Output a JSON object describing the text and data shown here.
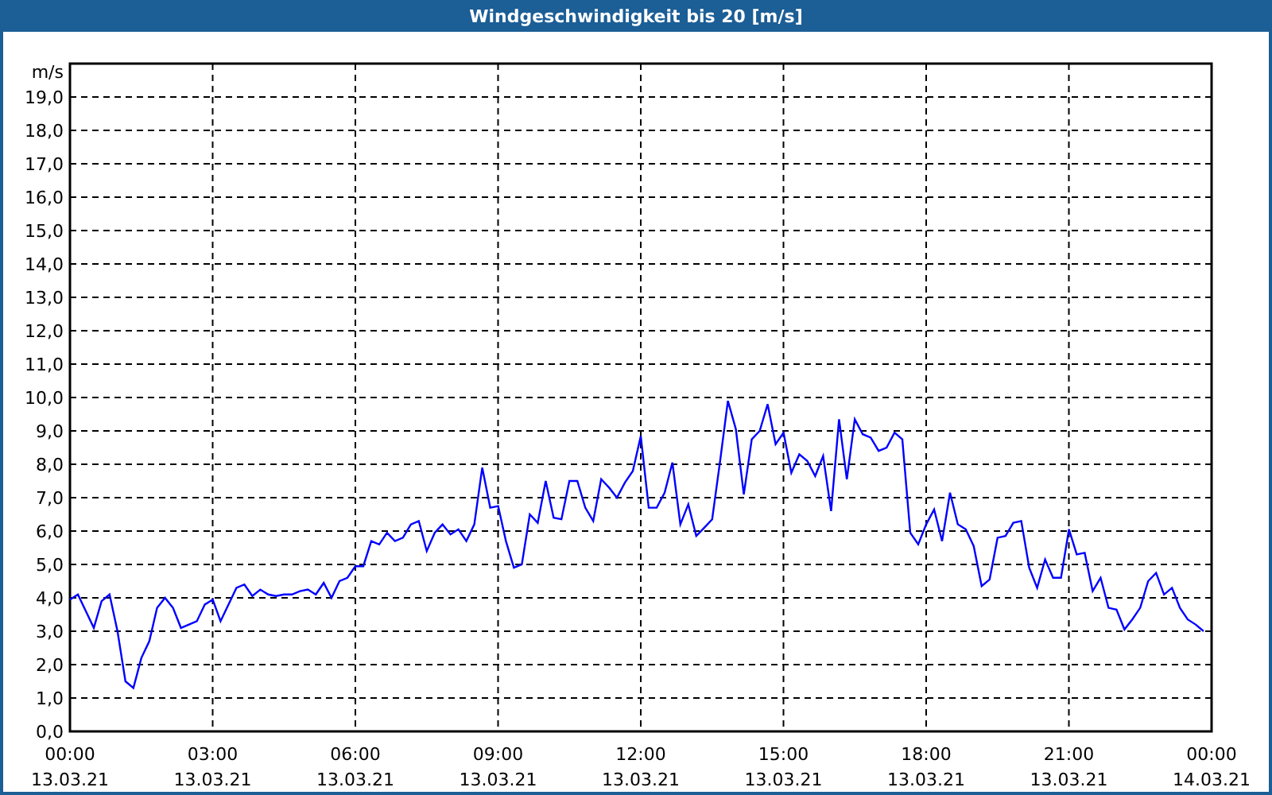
{
  "window": {
    "title": "Windgeschwindigkeit bis 20 [m/s]"
  },
  "chart_data": {
    "type": "line",
    "ylabel": "m/s",
    "categories": [
      "00:00\n13.03.21",
      null,
      null,
      null,
      null,
      null,
      null,
      null,
      null,
      null,
      null,
      null,
      null,
      null,
      null,
      null,
      null,
      null,
      "03:00\n13.03.21",
      null,
      null,
      null,
      null,
      null,
      null,
      null,
      null,
      null,
      null,
      null,
      null,
      null,
      null,
      null,
      null,
      null,
      "06:00\n13.03.21",
      null,
      null,
      null,
      null,
      null,
      null,
      null,
      null,
      null,
      null,
      null,
      null,
      null,
      null,
      null,
      null,
      null,
      "09:00\n13.03.21",
      null,
      null,
      null,
      null,
      null,
      null,
      null,
      null,
      null,
      null,
      null,
      null,
      null,
      null,
      null,
      null,
      null,
      "12:00\n13.03.21",
      null,
      null,
      null,
      null,
      null,
      null,
      null,
      null,
      null,
      null,
      null,
      null,
      null,
      null,
      null,
      null,
      null,
      "15:00\n13.03.21",
      null,
      null,
      null,
      null,
      null,
      null,
      null,
      null,
      null,
      null,
      null,
      null,
      null,
      null,
      null,
      null,
      null,
      "18:00\n13.03.21",
      null,
      null,
      null,
      null,
      null,
      null,
      null,
      null,
      null,
      null,
      null,
      null,
      null,
      null,
      null,
      null,
      null,
      "21:00\n13.03.21",
      null,
      null,
      null,
      null,
      null,
      null,
      null,
      null,
      null,
      null,
      null,
      null,
      null,
      null,
      null,
      null,
      null,
      "00:00\n14.03.21"
    ],
    "series": [
      {
        "color": "#0000ff",
        "values": [
          3.95,
          4.1,
          3.6,
          3.1,
          3.9,
          4.1,
          3.0,
          1.5,
          1.3,
          2.2,
          2.7,
          3.7,
          4.0,
          3.7,
          3.1,
          3.2,
          3.3,
          3.8,
          3.95,
          3.3,
          3.8,
          4.3,
          4.4,
          4.05,
          4.25,
          4.1,
          4.05,
          4.1,
          4.1,
          4.2,
          4.25,
          4.1,
          4.45,
          4.0,
          4.5,
          4.6,
          4.95,
          4.95,
          5.7,
          5.6,
          5.95,
          5.7,
          5.8,
          6.2,
          6.3,
          5.4,
          5.95,
          6.2,
          5.9,
          6.05,
          5.7,
          6.2,
          7.9,
          6.7,
          6.75,
          5.7,
          4.9,
          5.0,
          6.5,
          6.25,
          7.5,
          6.4,
          6.35,
          7.5,
          7.5,
          6.7,
          6.3,
          7.55,
          7.3,
          7.0,
          7.45,
          7.8,
          8.85,
          6.7,
          6.7,
          7.15,
          8.05,
          6.2,
          6.8,
          5.85,
          6.1,
          6.35,
          8.1,
          9.9,
          9.05,
          7.1,
          8.75,
          9.0,
          9.8,
          8.6,
          8.95,
          7.75,
          8.3,
          8.1,
          7.65,
          8.25,
          6.6,
          9.35,
          7.55,
          9.35,
          8.9,
          8.8,
          8.4,
          8.5,
          8.95,
          8.75,
          5.95,
          5.6,
          6.2,
          6.65,
          5.7,
          7.15,
          6.2,
          6.05,
          5.55,
          4.35,
          4.55,
          5.8,
          5.85,
          6.25,
          6.3,
          4.9,
          4.3,
          5.15,
          4.6,
          4.6,
          6.05,
          5.3,
          5.35,
          4.2,
          4.6,
          3.7,
          3.65,
          3.05,
          3.35,
          3.7,
          4.5,
          4.75,
          4.1,
          4.3,
          3.7,
          3.35,
          3.2,
          3.0,
          null
        ]
      }
    ],
    "grid": true,
    "ylim": [
      0,
      20
    ],
    "yticks": [
      {
        "value": 0,
        "label": "0,0"
      },
      {
        "value": 1,
        "label": "1,0"
      },
      {
        "value": 2,
        "label": "2,0"
      },
      {
        "value": 3,
        "label": "3,0"
      },
      {
        "value": 4,
        "label": "4,0"
      },
      {
        "value": 5,
        "label": "5,0"
      },
      {
        "value": 6,
        "label": "6,0"
      },
      {
        "value": 7,
        "label": "7,0"
      },
      {
        "value": 8,
        "label": "8,0"
      },
      {
        "value": 9,
        "label": "9,0"
      },
      {
        "value": 10,
        "label": "10,0"
      },
      {
        "value": 11,
        "label": "11,0"
      },
      {
        "value": 12,
        "label": "12,0"
      },
      {
        "value": 13,
        "label": "13,0"
      },
      {
        "value": 14,
        "label": "14,0"
      },
      {
        "value": 15,
        "label": "15,0"
      },
      {
        "value": 16,
        "label": "16,0"
      },
      {
        "value": 17,
        "label": "17,0"
      },
      {
        "value": 18,
        "label": "18,0"
      },
      {
        "value": 19,
        "label": "19,0"
      }
    ]
  }
}
